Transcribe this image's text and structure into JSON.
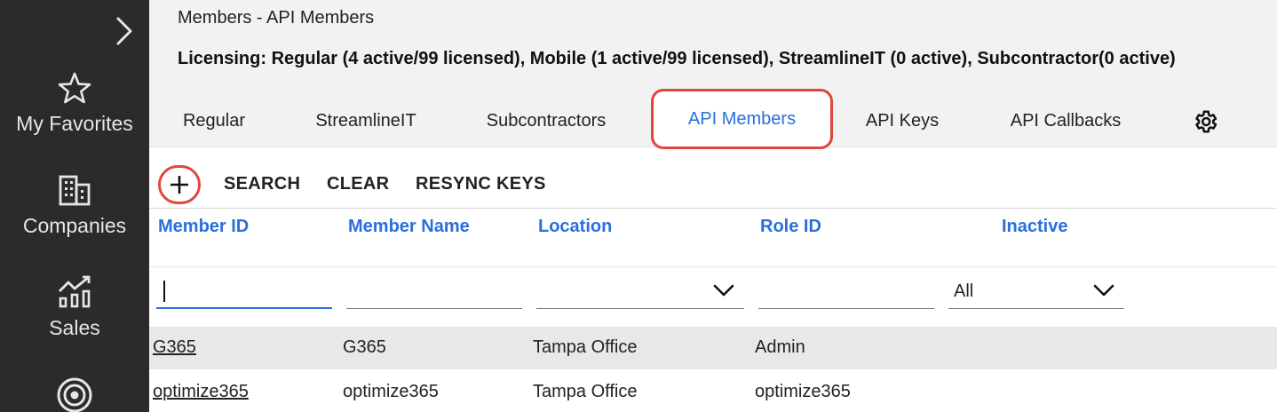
{
  "sidebar": {
    "items": [
      {
        "icon": "star-icon",
        "label": "My Favorites"
      },
      {
        "icon": "building-icon",
        "label": "Companies"
      },
      {
        "icon": "sales-chart-icon",
        "label": "Sales"
      },
      {
        "icon": "target-icon",
        "label": ""
      }
    ]
  },
  "header": {
    "title": "Members - API Members",
    "licensing": "Licensing: Regular (4 active/99 licensed), Mobile (1 active/99 licensed), StreamlineIT (0 active), Subcontractor(0 active)"
  },
  "tabs": [
    {
      "label": "Regular"
    },
    {
      "label": "StreamlineIT"
    },
    {
      "label": "Subcontractors"
    },
    {
      "label": "API Members",
      "active": true
    },
    {
      "label": "API Keys"
    },
    {
      "label": "API Callbacks"
    }
  ],
  "toolbar": {
    "add_icon": "plus-icon",
    "search_label": "SEARCH",
    "clear_label": "CLEAR",
    "resync_label": "RESYNC KEYS"
  },
  "table": {
    "columns": [
      "Member ID",
      "Member Name",
      "Location",
      "Role ID",
      "Inactive"
    ],
    "filters": {
      "member_id": "",
      "member_name": "",
      "location": "",
      "role_id": "",
      "inactive": "All"
    },
    "rows": [
      {
        "member_id": "G365",
        "member_name": "G365",
        "location": "Tampa Office",
        "role_id": "Admin"
      },
      {
        "member_id": "optimize365",
        "member_name": "optimize365",
        "location": "Tampa Office",
        "role_id": "optimize365"
      }
    ]
  },
  "colors": {
    "sidebar_bg": "#2b2b2b",
    "accent_blue": "#2a6fdb",
    "highlight_red": "#e0463a"
  }
}
